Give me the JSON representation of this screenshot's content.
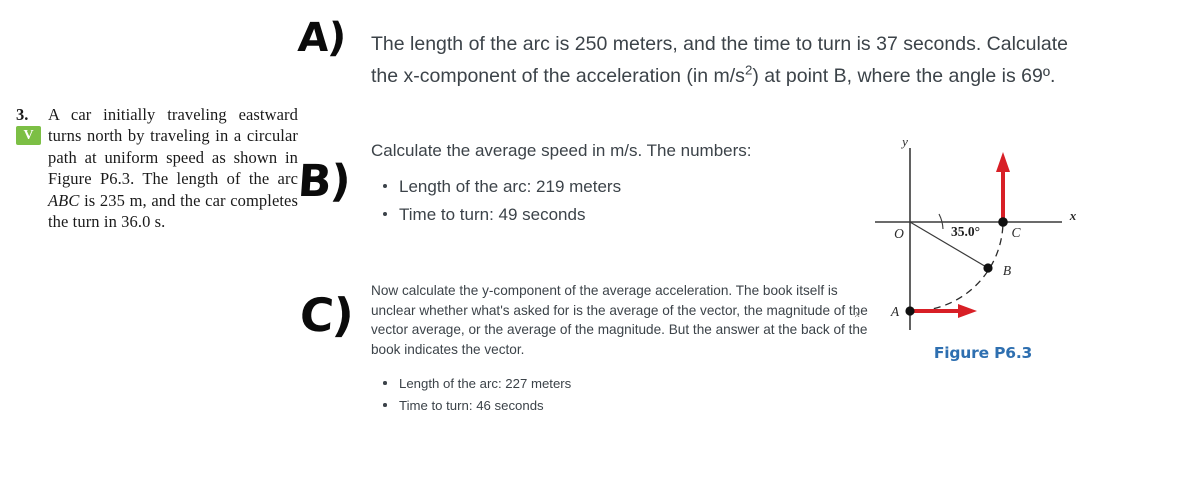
{
  "textbook": {
    "problem_number": "3.",
    "verified_badge": "V",
    "body_line1": "A car initially traveling",
    "body_line2": "eastward turns north by traveling in a circular path at uniform speed as shown in Figure P6.3. The length of the arc",
    "body_arc_label": "ABC",
    "body_line3": "is 235 m, and the car completes the turn in 36.0 s.",
    "full_text": "3. A car initially traveling eastward turns north by traveling in a circular path at uniform speed as shown in Figure P6.3. The length of the arc ABC is 235 m, and the car completes the turn in 36.0 s."
  },
  "parts": {
    "a": {
      "marker": "A)",
      "line1": "The length of the arc is 250 meters, and the time to turn is 37 seconds.  Calculate",
      "line2_pre": "the x-component of the acceleration (in m/s",
      "line2_sup": "2",
      "line2_post": ") at point B, where the angle is 69º."
    },
    "b": {
      "marker": "B)",
      "prompt": "Calculate the average speed in m/s.  The numbers:",
      "bullets": [
        "Length of the arc: 219 meters",
        "Time to turn: 49 seconds"
      ]
    },
    "c": {
      "marker": "C)",
      "paragraph": "Now calculate the y-component of the average acceleration.  The book itself is unclear whether what's asked for is the average of the vector, the magnitude of the vector average, or the average of the magnitude.  But the answer at the back of the book indicates the vector.",
      "bullets": [
        "Length of the arc: 227 meters",
        "Time to turn: 46 seconds"
      ]
    }
  },
  "figure": {
    "caption": "Figure P6.3",
    "caption_color": "#2e6fb0",
    "angle_label": "35.0°",
    "axis_x_label": "x",
    "axis_y_label": "y",
    "origin_label": "O",
    "point_a_label": "A",
    "point_b_label": "B",
    "point_c_label": "C",
    "vector_color": "#d81f26",
    "axis_color": "#3a3a3a",
    "speck_label": "x"
  }
}
